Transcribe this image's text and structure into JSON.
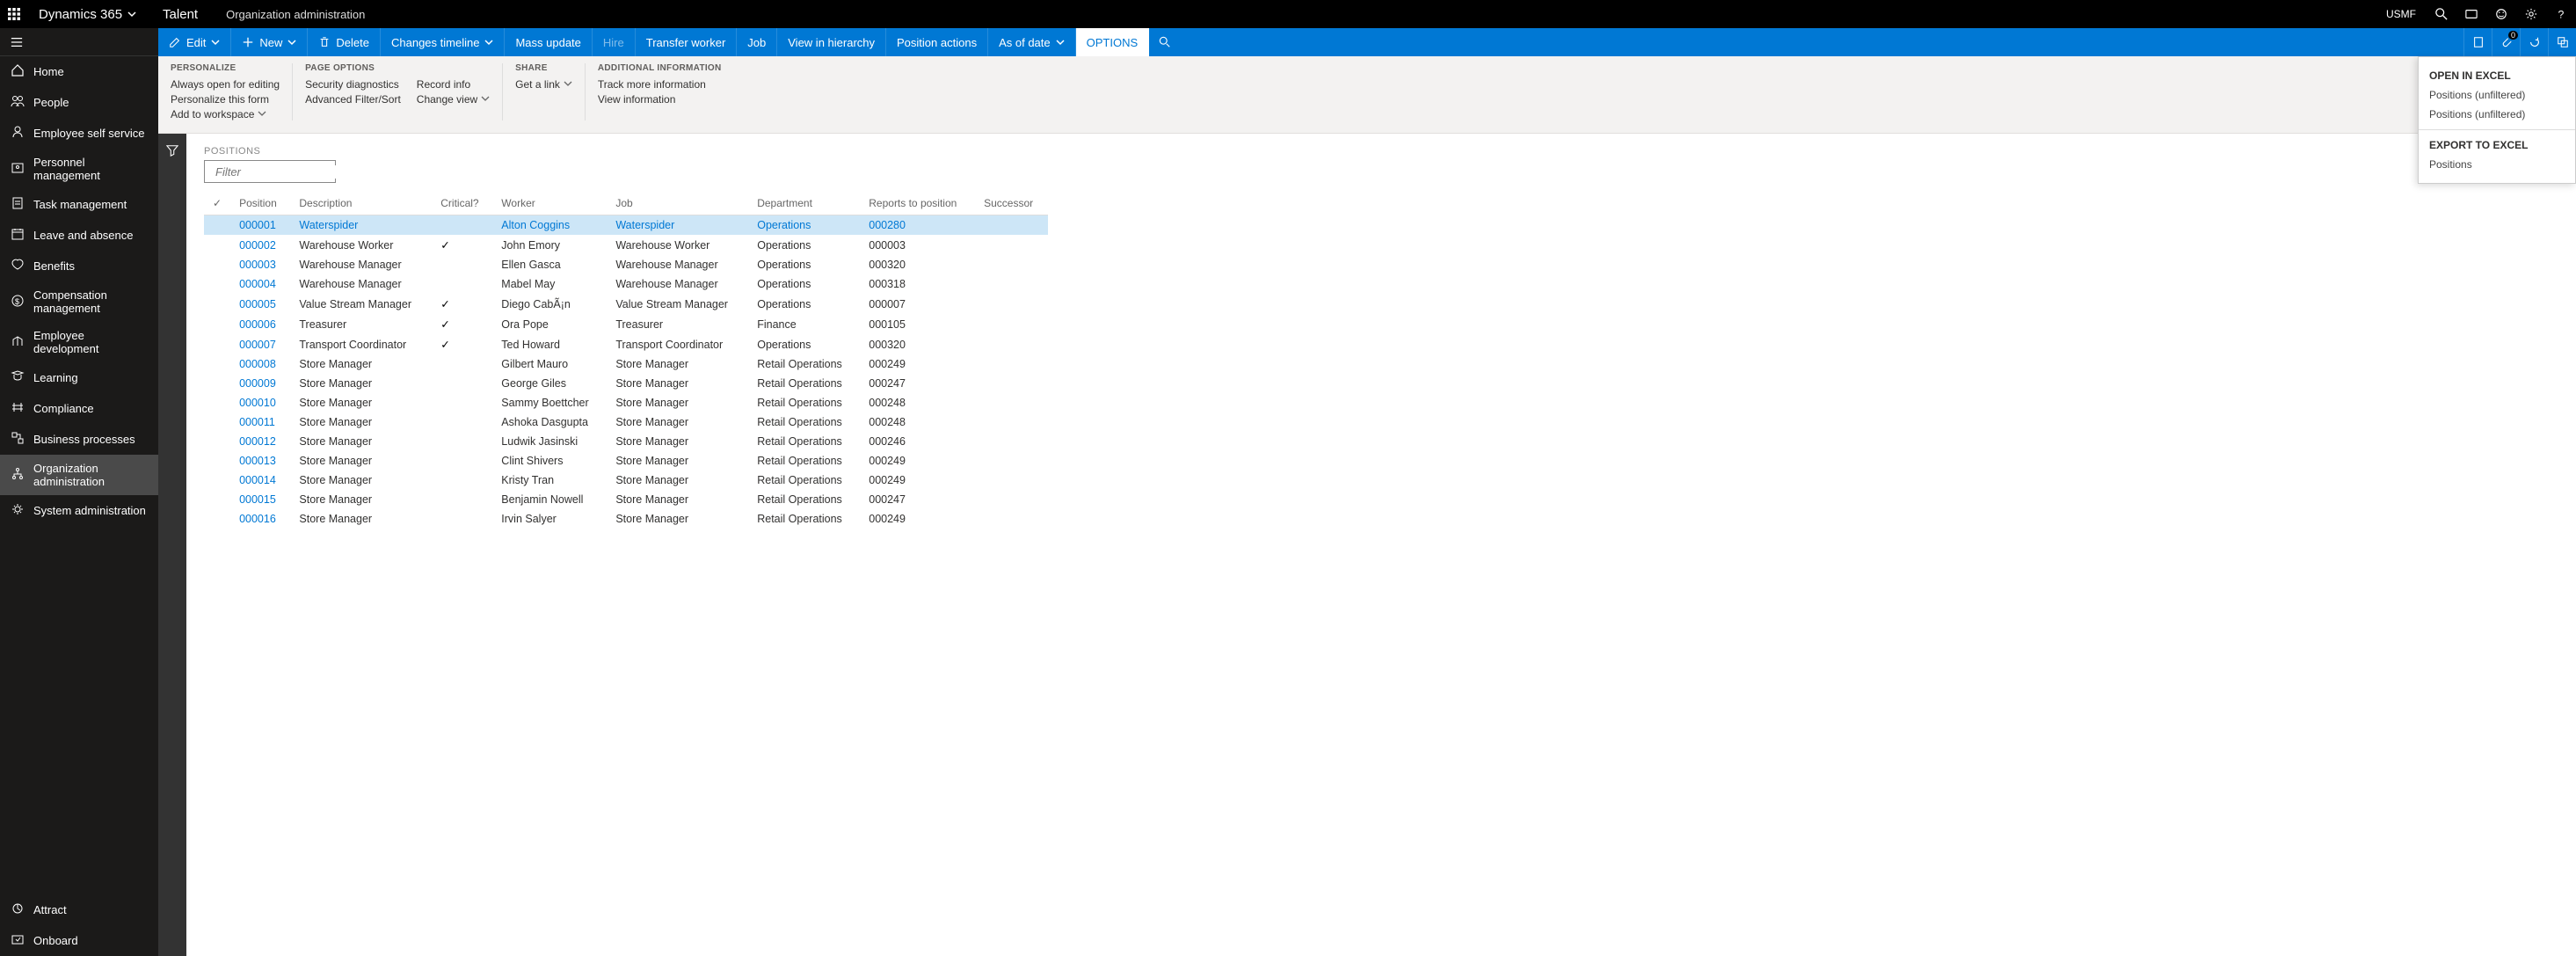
{
  "topbar": {
    "brand": "Dynamics 365",
    "talent": "Talent",
    "module": "Organization administration",
    "entity": "USMF"
  },
  "nav": {
    "items": [
      {
        "icon": "home",
        "label": "Home"
      },
      {
        "icon": "people",
        "label": "People"
      },
      {
        "icon": "self",
        "label": "Employee self service"
      },
      {
        "icon": "personnel",
        "label": "Personnel management"
      },
      {
        "icon": "task",
        "label": "Task management"
      },
      {
        "icon": "leave",
        "label": "Leave and absence"
      },
      {
        "icon": "benefits",
        "label": "Benefits"
      },
      {
        "icon": "comp",
        "label": "Compensation management"
      },
      {
        "icon": "dev",
        "label": "Employee development"
      },
      {
        "icon": "learn",
        "label": "Learning"
      },
      {
        "icon": "compliance",
        "label": "Compliance"
      },
      {
        "icon": "biz",
        "label": "Business processes"
      },
      {
        "icon": "org",
        "label": "Organization administration",
        "active": true
      },
      {
        "icon": "sys",
        "label": "System administration"
      }
    ],
    "bottom": [
      {
        "icon": "attract",
        "label": "Attract"
      },
      {
        "icon": "onboard",
        "label": "Onboard"
      }
    ]
  },
  "actionbar": {
    "edit": "Edit",
    "new": "New",
    "delete": "Delete",
    "changes": "Changes timeline",
    "mass": "Mass update",
    "hire": "Hire",
    "transfer": "Transfer worker",
    "job": "Job",
    "hierarchy": "View in hierarchy",
    "posactions": "Position actions",
    "asof": "As of date",
    "options": "OPTIONS",
    "bellcount": "0"
  },
  "optionsbar": {
    "personalize": {
      "title": "PERSONALIZE",
      "links": [
        "Always open for editing",
        "Personalize this form",
        "Add to workspace"
      ]
    },
    "page": {
      "title": "PAGE OPTIONS",
      "col1": [
        "Security diagnostics",
        "Advanced Filter/Sort"
      ],
      "col2": [
        "Record info",
        "Change view"
      ]
    },
    "share": {
      "title": "SHARE",
      "links": [
        "Get a link"
      ]
    },
    "addl": {
      "title": "ADDITIONAL INFORMATION",
      "links": [
        "Track more information",
        "View information"
      ]
    }
  },
  "grid": {
    "title": "POSITIONS",
    "filter_placeholder": "Filter",
    "columns": [
      "Position",
      "Description",
      "Critical?",
      "Worker",
      "Job",
      "Department",
      "Reports to position",
      "Successor"
    ],
    "rows": [
      {
        "pos": "000001",
        "desc": "Waterspider",
        "crit": "",
        "worker": "Alton Coggins",
        "job": "Waterspider",
        "dept": "Operations",
        "reports": "000280",
        "succ": "",
        "selected": true
      },
      {
        "pos": "000002",
        "desc": "Warehouse Worker",
        "crit": "✓",
        "worker": "John Emory",
        "job": "Warehouse Worker",
        "dept": "Operations",
        "reports": "000003",
        "succ": ""
      },
      {
        "pos": "000003",
        "desc": "Warehouse Manager",
        "crit": "",
        "worker": "Ellen Gasca",
        "job": "Warehouse Manager",
        "dept": "Operations",
        "reports": "000320",
        "succ": ""
      },
      {
        "pos": "000004",
        "desc": "Warehouse Manager",
        "crit": "",
        "worker": "Mabel May",
        "job": "Warehouse Manager",
        "dept": "Operations",
        "reports": "000318",
        "succ": ""
      },
      {
        "pos": "000005",
        "desc": "Value Stream Manager",
        "crit": "✓",
        "worker": "Diego CabÃ¡n",
        "job": "Value Stream Manager",
        "dept": "Operations",
        "reports": "000007",
        "succ": ""
      },
      {
        "pos": "000006",
        "desc": "Treasurer",
        "crit": "✓",
        "worker": "Ora Pope",
        "job": "Treasurer",
        "dept": "Finance",
        "reports": "000105",
        "succ": ""
      },
      {
        "pos": "000007",
        "desc": "Transport Coordinator",
        "crit": "✓",
        "worker": "Ted Howard",
        "job": "Transport Coordinator",
        "dept": "Operations",
        "reports": "000320",
        "succ": ""
      },
      {
        "pos": "000008",
        "desc": "Store Manager",
        "crit": "",
        "worker": "Gilbert Mauro",
        "job": "Store Manager",
        "dept": "Retail Operations",
        "reports": "000249",
        "succ": ""
      },
      {
        "pos": "000009",
        "desc": "Store Manager",
        "crit": "",
        "worker": "George Giles",
        "job": "Store Manager",
        "dept": "Retail Operations",
        "reports": "000247",
        "succ": ""
      },
      {
        "pos": "000010",
        "desc": "Store Manager",
        "crit": "",
        "worker": "Sammy Boettcher",
        "job": "Store Manager",
        "dept": "Retail Operations",
        "reports": "000248",
        "succ": ""
      },
      {
        "pos": "000011",
        "desc": "Store Manager",
        "crit": "",
        "worker": "Ashoka Dasgupta",
        "job": "Store Manager",
        "dept": "Retail Operations",
        "reports": "000248",
        "succ": ""
      },
      {
        "pos": "000012",
        "desc": "Store Manager",
        "crit": "",
        "worker": "Ludwik Jasinski",
        "job": "Store Manager",
        "dept": "Retail Operations",
        "reports": "000246",
        "succ": ""
      },
      {
        "pos": "000013",
        "desc": "Store Manager",
        "crit": "",
        "worker": "Clint Shivers",
        "job": "Store Manager",
        "dept": "Retail Operations",
        "reports": "000249",
        "succ": ""
      },
      {
        "pos": "000014",
        "desc": "Store Manager",
        "crit": "",
        "worker": "Kristy Tran",
        "job": "Store Manager",
        "dept": "Retail Operations",
        "reports": "000249",
        "succ": ""
      },
      {
        "pos": "000015",
        "desc": "Store Manager",
        "crit": "",
        "worker": "Benjamin Nowell",
        "job": "Store Manager",
        "dept": "Retail Operations",
        "reports": "000247",
        "succ": ""
      },
      {
        "pos": "000016",
        "desc": "Store Manager",
        "crit": "",
        "worker": "Irvin Salyer",
        "job": "Store Manager",
        "dept": "Retail Operations",
        "reports": "000249",
        "succ": ""
      }
    ]
  },
  "flyout": {
    "open_title": "OPEN IN EXCEL",
    "open_items": [
      "Positions (unfiltered)",
      "Positions (unfiltered)"
    ],
    "export_title": "EXPORT TO EXCEL",
    "export_items": [
      "Positions"
    ]
  }
}
